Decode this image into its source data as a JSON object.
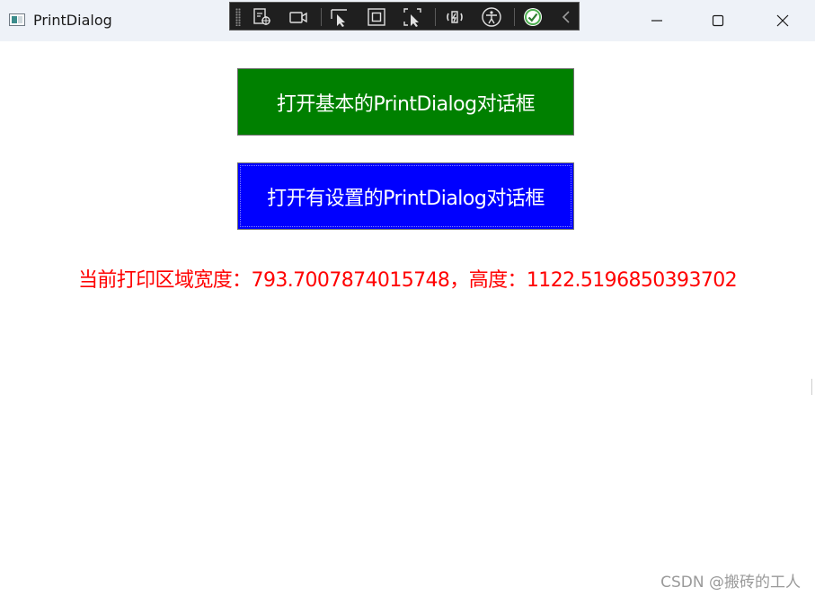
{
  "window": {
    "title": "PrintDialog",
    "controls": [
      "minimize-icon",
      "maximize-icon",
      "close-icon"
    ]
  },
  "debug_toolbar": {
    "icons": [
      "select-element-icon",
      "video-record-icon",
      "pointer-select-icon",
      "layout-adorner-icon",
      "track-focus-icon",
      "hot-reload-icon",
      "accessibility-icon",
      "status-check-icon",
      "collapse-chevron-icon"
    ],
    "status_color": "#4caf50"
  },
  "main": {
    "basic_button_label": "打开基本的PrintDialog对话框",
    "settings_button_label": "打开有设置的PrintDialog对话框",
    "area_text": "当前打印区域宽度：793.7007874015748，高度：1122.5196850393702"
  },
  "colors": {
    "basic_button": "#008000",
    "settings_button": "#0000ff",
    "area_text": "#ff0000"
  },
  "watermark": "CSDN @搬砖的工人"
}
